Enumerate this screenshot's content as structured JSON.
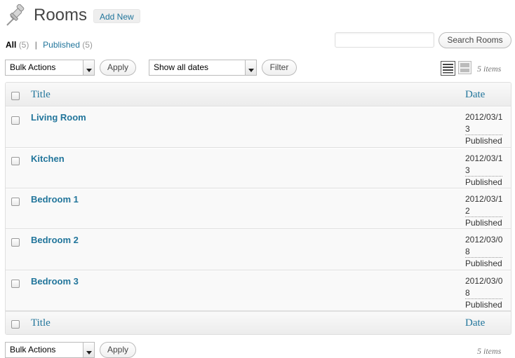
{
  "header": {
    "title": "Rooms",
    "add_new": "Add New",
    "icon": "pushpin-icon"
  },
  "views": {
    "all_label": "All",
    "all_count": "(5)",
    "separator": "|",
    "published_label": "Published",
    "published_count": "(5)"
  },
  "search": {
    "placeholder": "",
    "button": "Search Rooms"
  },
  "tablenav_top": {
    "bulk_actions": "Bulk Actions",
    "apply": "Apply",
    "dates": "Show all dates",
    "filter": "Filter",
    "items": "5 items"
  },
  "table": {
    "columns": {
      "title": "Title",
      "date": "Date"
    },
    "rows": [
      {
        "title": "Living Room",
        "date_l1": "2012/03/1",
        "date_l2": "3",
        "status": "Published"
      },
      {
        "title": "Kitchen",
        "date_l1": "2012/03/1",
        "date_l2": "3",
        "status": "Published"
      },
      {
        "title": "Bedroom 1",
        "date_l1": "2012/03/1",
        "date_l2": "2",
        "status": "Published"
      },
      {
        "title": "Bedroom 2",
        "date_l1": "2012/03/0",
        "date_l2": "8",
        "status": "Published"
      },
      {
        "title": "Bedroom 3",
        "date_l1": "2012/03/0",
        "date_l2": "8",
        "status": "Published"
      }
    ]
  },
  "tablenav_bottom": {
    "bulk_actions": "Bulk Actions",
    "apply": "Apply",
    "items": "5 items"
  },
  "colors": {
    "link": "#21759b",
    "table_bg": "#f9f9f9",
    "border": "#dfdfdf"
  }
}
